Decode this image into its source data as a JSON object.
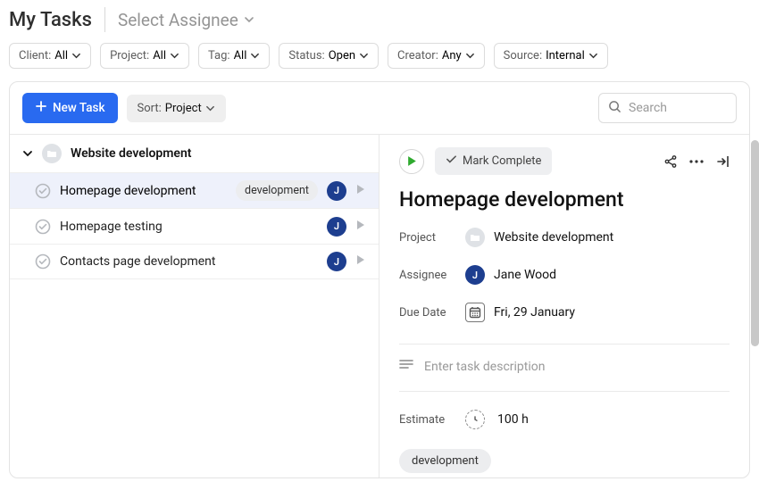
{
  "header": {
    "title": "My Tasks",
    "assignee_selector": "Select Assignee"
  },
  "filters": [
    {
      "label": "Client:",
      "value": "All"
    },
    {
      "label": "Project:",
      "value": "All"
    },
    {
      "label": "Tag:",
      "value": "All"
    },
    {
      "label": "Status:",
      "value": "Open"
    },
    {
      "label": "Creator:",
      "value": "Any"
    },
    {
      "label": "Source:",
      "value": "Internal"
    }
  ],
  "toolbar": {
    "new_task": "New Task",
    "sort_label": "Sort:",
    "sort_value": "Project",
    "search_placeholder": "Search"
  },
  "group": {
    "name": "Website development"
  },
  "tasks": [
    {
      "name": "Homepage development",
      "tag": "development",
      "avatar": "J",
      "selected": true
    },
    {
      "name": "Homepage testing",
      "tag": null,
      "avatar": "J",
      "selected": false
    },
    {
      "name": "Contacts page development",
      "tag": null,
      "avatar": "J",
      "selected": false
    }
  ],
  "detail": {
    "mark_complete": "Mark Complete",
    "title": "Homepage development",
    "project_label": "Project",
    "project_value": "Website development",
    "assignee_label": "Assignee",
    "assignee_avatar": "J",
    "assignee_value": "Jane Wood",
    "due_label": "Due Date",
    "due_value": "Fri, 29 January",
    "desc_placeholder": "Enter task description",
    "estimate_label": "Estimate",
    "estimate_value": "100 h",
    "tag": "development"
  }
}
